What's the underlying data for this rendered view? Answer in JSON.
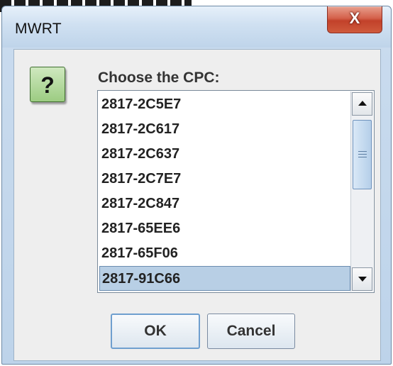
{
  "window": {
    "title": "MWRT",
    "close_label": "X"
  },
  "icon": {
    "name": "question-icon",
    "glyph": "?",
    "color": "#9ccc82"
  },
  "dialog": {
    "prompt": "Choose the CPC:",
    "items": [
      "2817-2C5E7",
      "2817-2C617",
      "2817-2C637",
      "2817-2C7E7",
      "2817-2C847",
      "2817-65EE6",
      "2817-65F06",
      "2817-91C66"
    ],
    "selected_index": 7,
    "selection_color": "#b8cfe5"
  },
  "buttons": {
    "ok_label": "OK",
    "cancel_label": "Cancel"
  }
}
